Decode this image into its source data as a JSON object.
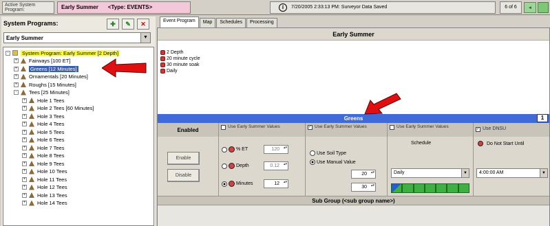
{
  "topbar": {
    "label": "Active System Program:",
    "program": "Early Summer",
    "type": "<Type: EVENTS>",
    "info_icon": "info-icon",
    "status": "7/20/2005 2:33:13 PM: Surveyor Data Saved",
    "page": "6 of 6"
  },
  "left": {
    "header": "System Programs:",
    "combo_value": "Early Summer",
    "tree": [
      {
        "label": "System Program: Early Summer  [2 Depth]",
        "level": 0,
        "style": "hl",
        "exp": "-"
      },
      {
        "label": "Fairways  [100 ET]",
        "level": 1,
        "style": "",
        "exp": "+"
      },
      {
        "label": "Greens  [12 Minutes]",
        "level": 1,
        "style": "sel",
        "exp": "+"
      },
      {
        "label": "Ornamentals  [20 Minutes]",
        "level": 1,
        "style": "",
        "exp": "+"
      },
      {
        "label": "Roughs  [15 Minutes]",
        "level": 1,
        "style": "",
        "exp": "+"
      },
      {
        "label": "Tees  [25 Minutes]",
        "level": 1,
        "style": "",
        "exp": "-"
      },
      {
        "label": "Hole 1 Tees",
        "level": 2,
        "style": "",
        "exp": "+"
      },
      {
        "label": "Hole 2 Tees  [60 Minutes]",
        "level": 2,
        "style": "",
        "exp": "+"
      },
      {
        "label": "Hole 3 Tees",
        "level": 2,
        "style": "",
        "exp": "+"
      },
      {
        "label": "Hole 4 Tees",
        "level": 2,
        "style": "",
        "exp": "+"
      },
      {
        "label": "Hole 5 Tees",
        "level": 2,
        "style": "",
        "exp": "+"
      },
      {
        "label": "Hole 6 Tees",
        "level": 2,
        "style": "",
        "exp": "+"
      },
      {
        "label": "Hole 7 Tees",
        "level": 2,
        "style": "",
        "exp": "+"
      },
      {
        "label": "Hole 8 Tees",
        "level": 2,
        "style": "",
        "exp": "+"
      },
      {
        "label": "Hole 9 Tees",
        "level": 2,
        "style": "",
        "exp": "+"
      },
      {
        "label": "Hole 10 Tees",
        "level": 2,
        "style": "",
        "exp": "+"
      },
      {
        "label": "Hole 11 Tees",
        "level": 2,
        "style": "",
        "exp": "+"
      },
      {
        "label": "Hole 12 Tees",
        "level": 2,
        "style": "",
        "exp": "+"
      },
      {
        "label": "Hole 13 Tees",
        "level": 2,
        "style": "",
        "exp": "+"
      },
      {
        "label": "Hole 14 Tees",
        "level": 2,
        "style": "",
        "exp": "+"
      }
    ]
  },
  "tabs": [
    "Event Program",
    "Map",
    "Schedules",
    "Processing"
  ],
  "main": {
    "title": "Early Summer",
    "schedule_lines": [
      "2 Depth",
      "20 minute cycle",
      "30 minute soak",
      "Daily"
    ],
    "group_title": "Greens",
    "group_number": "1",
    "enabled_header": "Enabled",
    "enable_button": "Enable",
    "disable_button": "Disable",
    "use_es_values": "Use Early Summer Values",
    "et_label": "% ET",
    "et_value": "120",
    "depth_label": "Depth",
    "depth_value": "0.12",
    "minutes_label": "Minutes",
    "minutes_value": "12",
    "soil_label": "Use Soil Type",
    "manual_label": "Use Manual Value",
    "manual_val1": "20",
    "manual_val2": "30",
    "schedule_label": "Schedule",
    "schedule_select": "Daily",
    "use_dnsu": "Use DNSU",
    "do_not_start": "Do Not Start Until",
    "start_time": "4:00:00 AM",
    "subgroup": "Sub Group (<sub group name>)"
  }
}
